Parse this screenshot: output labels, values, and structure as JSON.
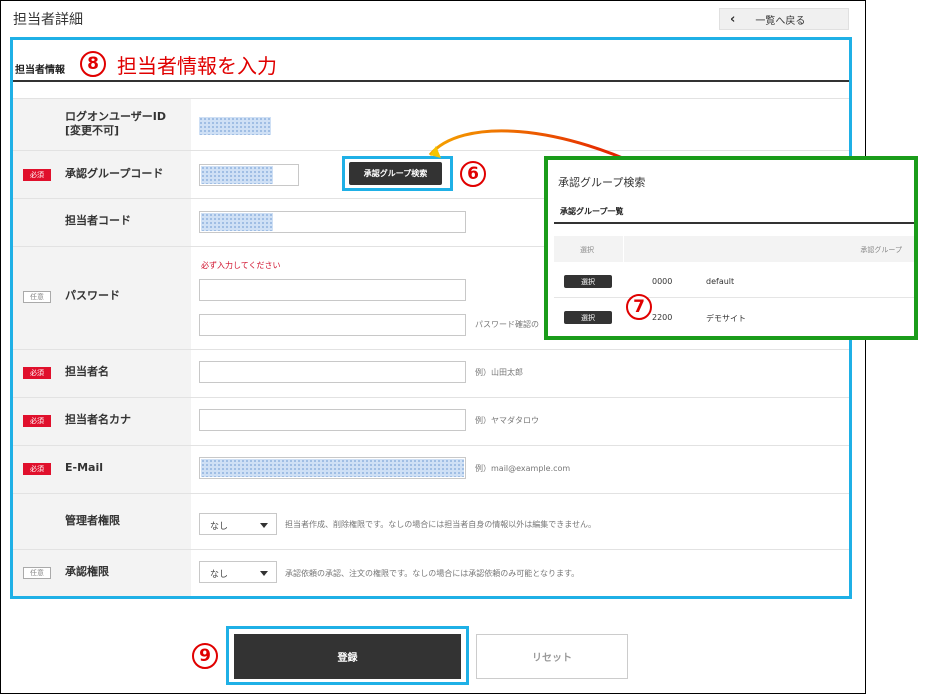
{
  "header": {
    "title": "担当者詳細",
    "back_label": "一覧へ戻る"
  },
  "section": {
    "label": "担当者情報"
  },
  "annotations": {
    "n8": "8",
    "n8_text": "担当者情報を入力",
    "n6": "6",
    "n7": "7",
    "n9": "9"
  },
  "badges": {
    "required": "必須",
    "optional": "任意"
  },
  "form": {
    "login_id_label": "ログオンユーザーID",
    "login_id_note": "[変更不可]",
    "approval_code_label": "承認グループコード",
    "approval_search_button": "承認グループ検索",
    "staff_code_label": "担当者コード",
    "password_label": "パスワード",
    "password_warning": "必ず入力してください",
    "password_confirm_hint": "パスワード確認の",
    "name_label": "担当者名",
    "name_hint": "例）山田太郎",
    "kana_label": "担当者名カナ",
    "kana_hint": "例）ヤマダタロウ",
    "email_label": "E-Mail",
    "email_hint": "例）mail@example.com",
    "admin_label": "管理者権限",
    "admin_value": "なし",
    "admin_hint": "担当者作成、削除権限です。なしの場合には担当者自身の情報以外は編集できません。",
    "approve_label": "承認権限",
    "approve_value": "なし",
    "approve_hint": "承認依頼の承認、注文の権限です。なしの場合には承認依頼のみ可能となります。"
  },
  "popup": {
    "title": "承認グループ検索",
    "subtitle": "承認グループ一覧",
    "col_select": "選択",
    "col_group": "承認グループ",
    "select_label": "選択",
    "rows": [
      {
        "code": "0000",
        "name": "default"
      },
      {
        "code": "2200",
        "name": "デモサイト"
      }
    ]
  },
  "actions": {
    "submit": "登録",
    "reset": "リセット"
  },
  "colors": {
    "highlight_blue": "#1fb0e6",
    "popup_green": "#1a9c1a",
    "annotation_red": "#e00000",
    "required_red": "#e0102c"
  }
}
